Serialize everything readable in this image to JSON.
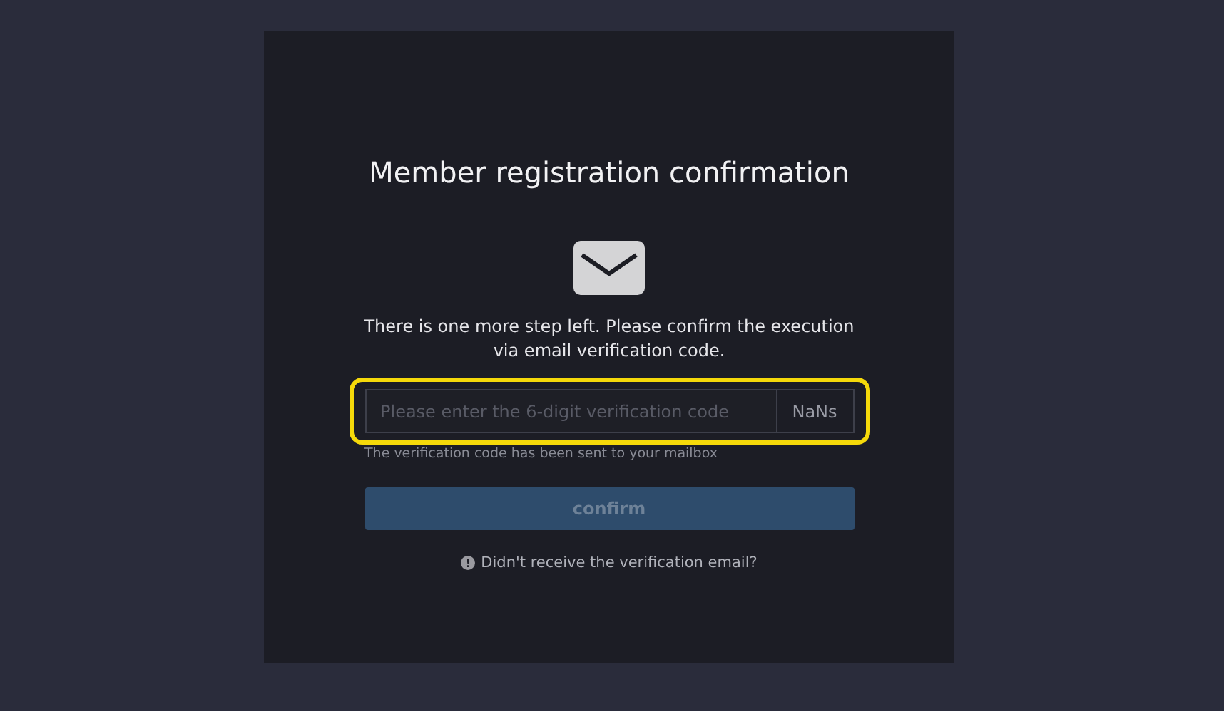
{
  "dialog": {
    "title": "Member registration confirmation",
    "message": "There is one more step left. Please confirm the execution via email verification code.",
    "code_field": {
      "placeholder": "Please enter the 6-digit verification code",
      "timer": "NaNs",
      "highlighted": true
    },
    "hint": "The verification code has been sent to your mailbox",
    "confirm_button": {
      "label": "confirm",
      "disabled": true
    },
    "help_link": {
      "icon": "!",
      "label": "Didn't receive the verification email?"
    }
  }
}
